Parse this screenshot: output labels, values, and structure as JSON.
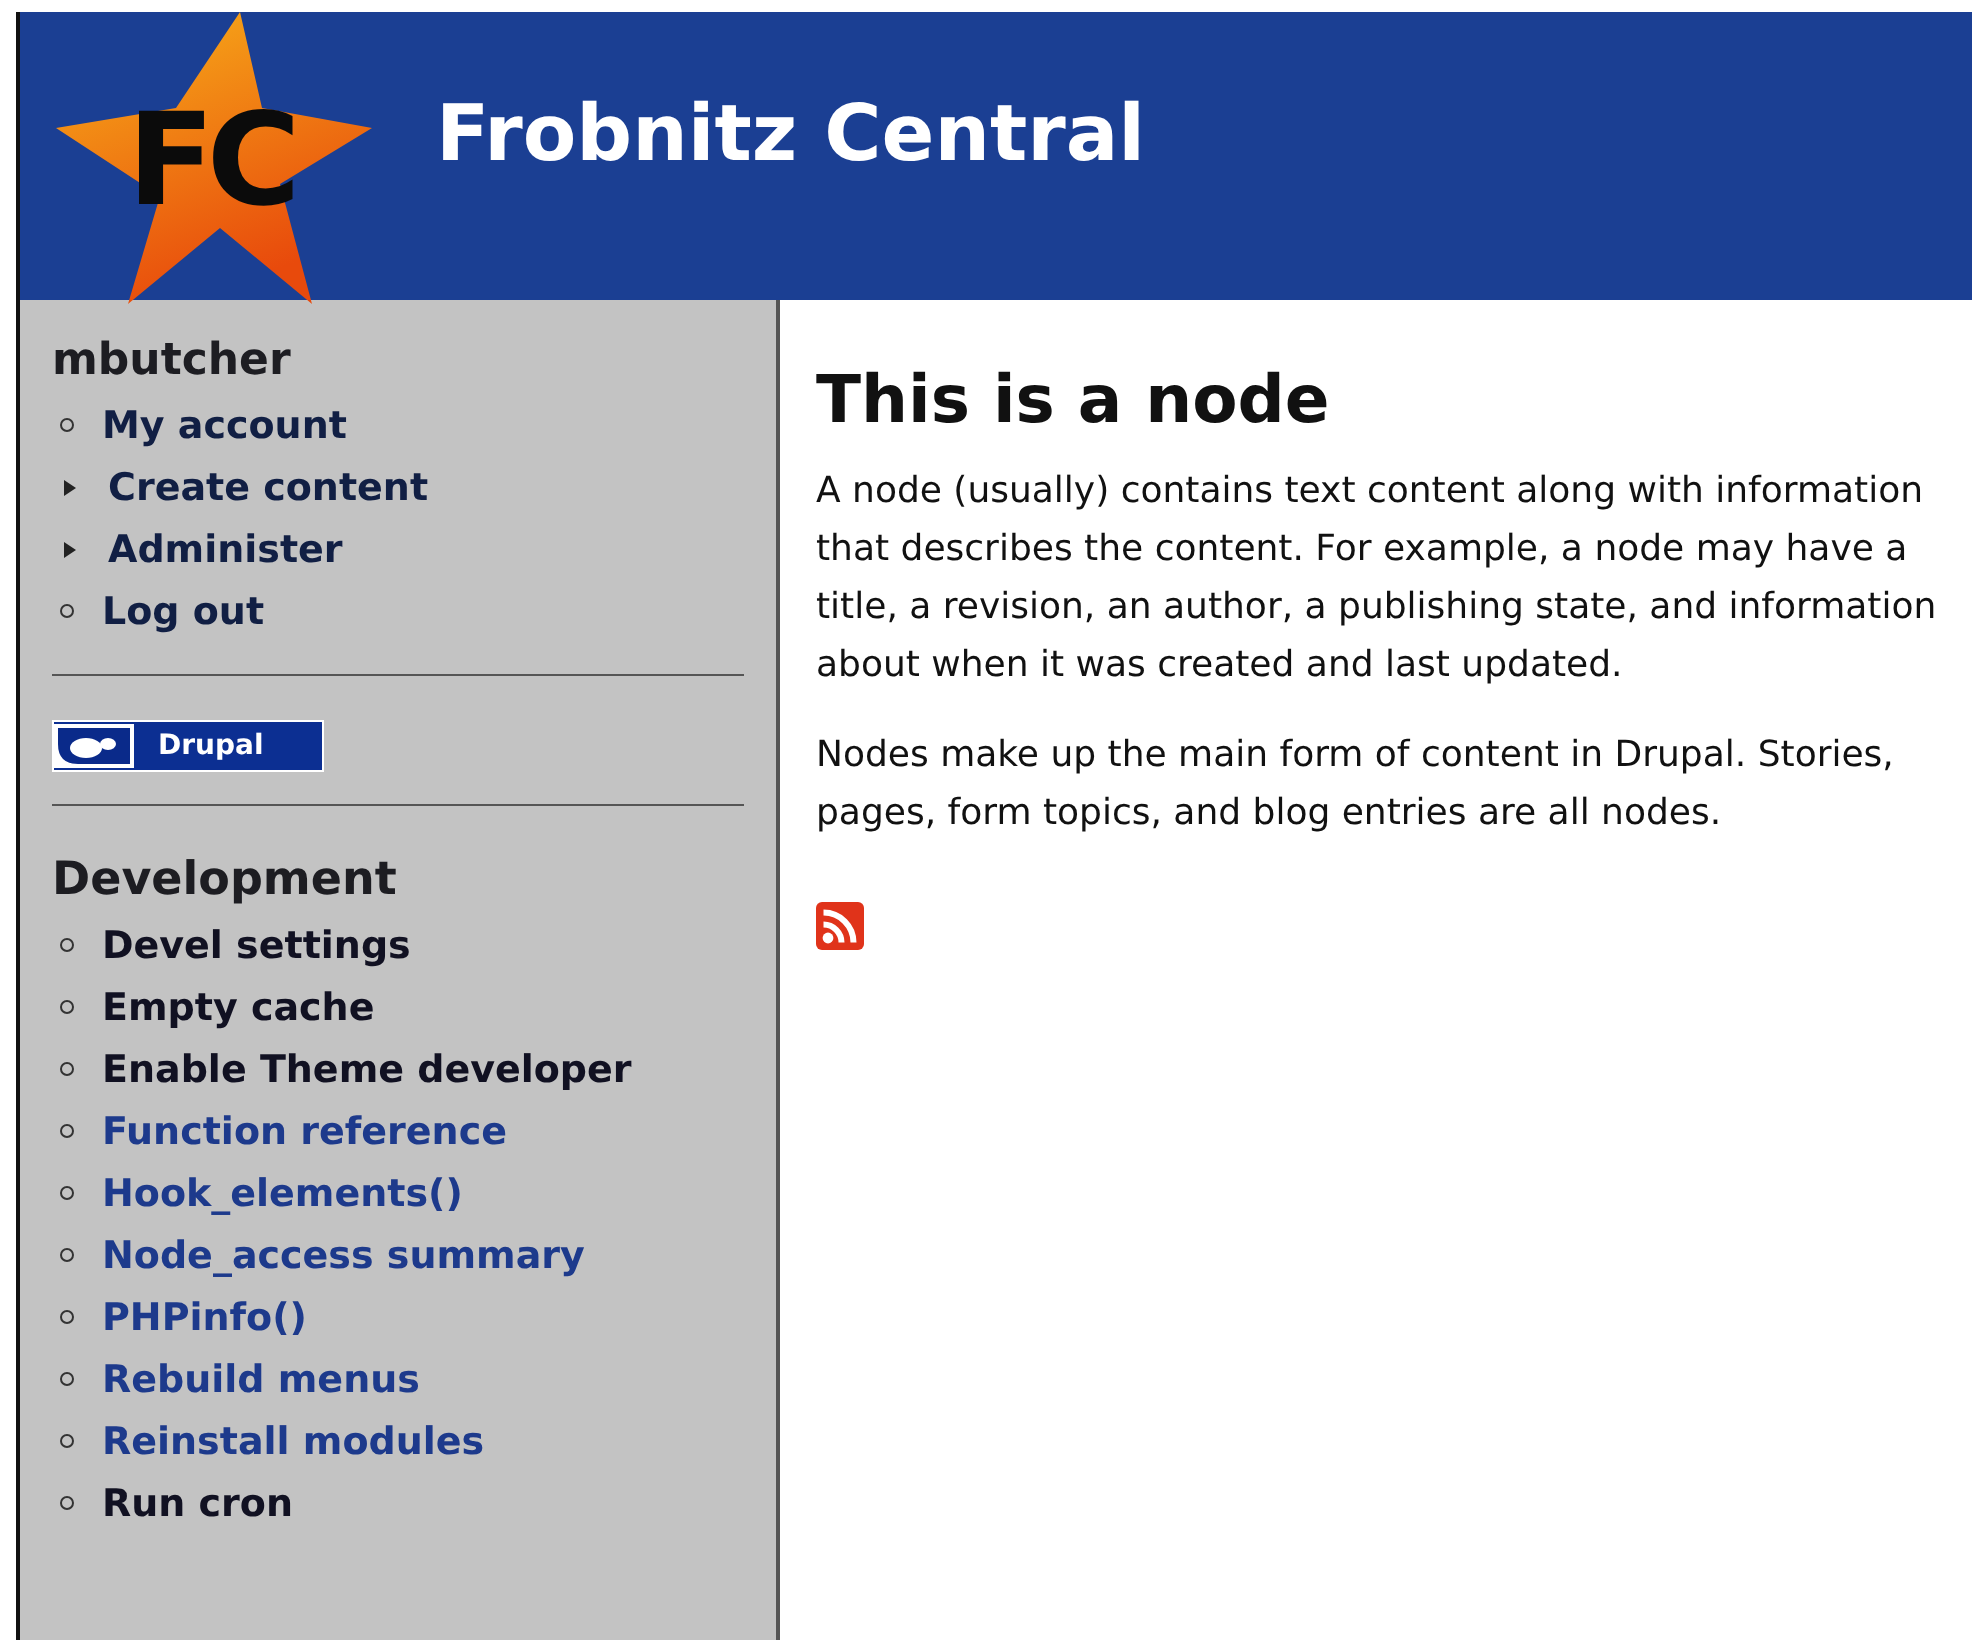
{
  "header": {
    "logo_text": "FC",
    "site_name": "Frobnitz Central"
  },
  "user_block": {
    "title": "mbutcher",
    "items": [
      {
        "label": "My account",
        "kind": "leaf"
      },
      {
        "label": "Create content",
        "kind": "collapsed"
      },
      {
        "label": "Administer",
        "kind": "collapsed"
      },
      {
        "label": "Log out",
        "kind": "leaf"
      }
    ]
  },
  "badge": {
    "label": "Drupal"
  },
  "dev_block": {
    "title": "Development",
    "items": [
      {
        "label": "Devel settings",
        "color": "#111122"
      },
      {
        "label": "Empty cache",
        "color": "#111122"
      },
      {
        "label": "Enable Theme developer",
        "color": "#111122"
      },
      {
        "label": "Function reference",
        "color": "#1d3a8c"
      },
      {
        "label": "Hook_elements()",
        "color": "#1d3a8c"
      },
      {
        "label": "Node_access summary",
        "color": "#1d3a8c"
      },
      {
        "label": "PHPinfo()",
        "color": "#1d3a8c"
      },
      {
        "label": "Rebuild menus",
        "color": "#1d3a8c"
      },
      {
        "label": "Reinstall modules",
        "color": "#1d3a8c"
      },
      {
        "label": "Run cron",
        "color": "#111122"
      }
    ]
  },
  "node": {
    "title": "This is a node",
    "paragraphs": [
      "A node (usually) contains text content along with information that describes the content. For example, a node may have a title, a revision, an author, a publishing state, and information about when it was created and last updated.",
      "Nodes make up the main form of content in Drupal. Stories, pages, form topics, and blog entries are all nodes."
    ]
  }
}
